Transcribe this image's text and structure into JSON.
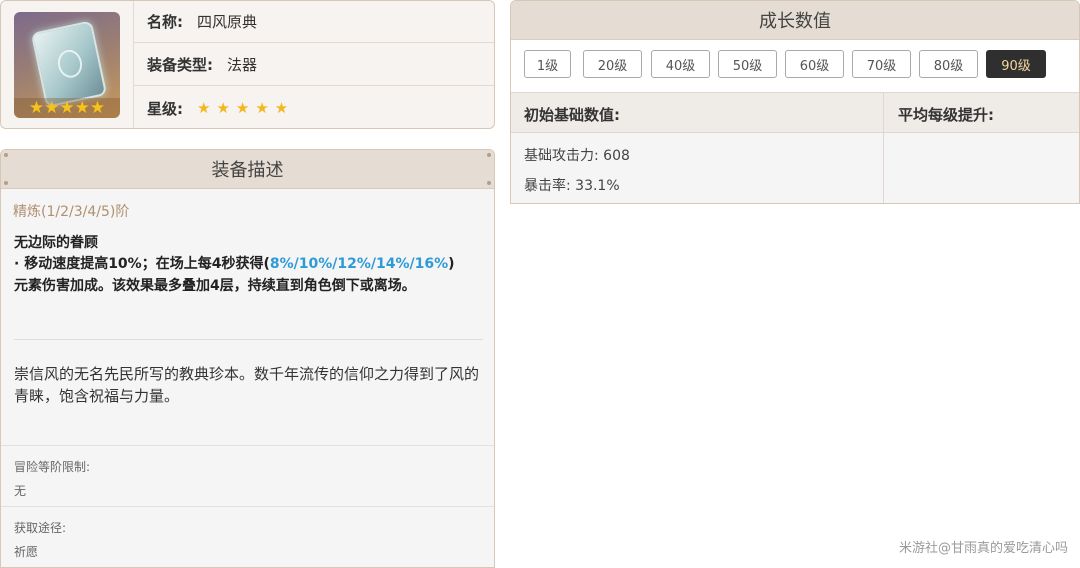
{
  "info": {
    "name_label": "名称:",
    "name_value": "四风原典",
    "type_label": "装备类型:",
    "type_value": "法器",
    "rarity_label": "星级:",
    "rarity_stars": "★★★★★",
    "thumb_stars": "★★★★★"
  },
  "description": {
    "header": "装备描述",
    "refine_tag": "精炼(1/2/3/4/5)阶",
    "passive_title": "无边际的眷顾",
    "passive_line1_prefix": "· 移动速度提高10%；在场上每4秒获得(",
    "passive_highlight": "8%/10%/12%/14%/16%",
    "passive_line1_suffix": ")",
    "passive_line2": "元素伤害加成。该效果最多叠加4层，持续直到角色倒下或离场。",
    "lore": "崇信风的无名先民所写的教典珍本。数千年流传的信仰之力得到了风的青睐，饱含祝福与力量。",
    "adventure_rank_label": "冒险等阶限制:",
    "adventure_rank_value": "无",
    "source_label": "获取途径:",
    "source_value": "祈愿"
  },
  "growth": {
    "header": "成长数值",
    "levels": [
      "1级",
      "20级",
      "40级",
      "50级",
      "60级",
      "70级",
      "80级",
      "90级"
    ],
    "active_level": "90级",
    "base_header": "初始基础数值:",
    "per_level_header": "平均每级提升:",
    "base_atk": "基础攻击力: 608",
    "crit_rate": "暴击率: 33.1%"
  },
  "watermark": "米游社@甘雨真的爱吃清心吗",
  "colors": {
    "accent_highlight": "#2e9ad8",
    "active_level_bg": "#2f2f2f",
    "active_level_text": "#f1d7a2",
    "star": "#f2b81d",
    "header_bg": "#e5dcd3"
  }
}
